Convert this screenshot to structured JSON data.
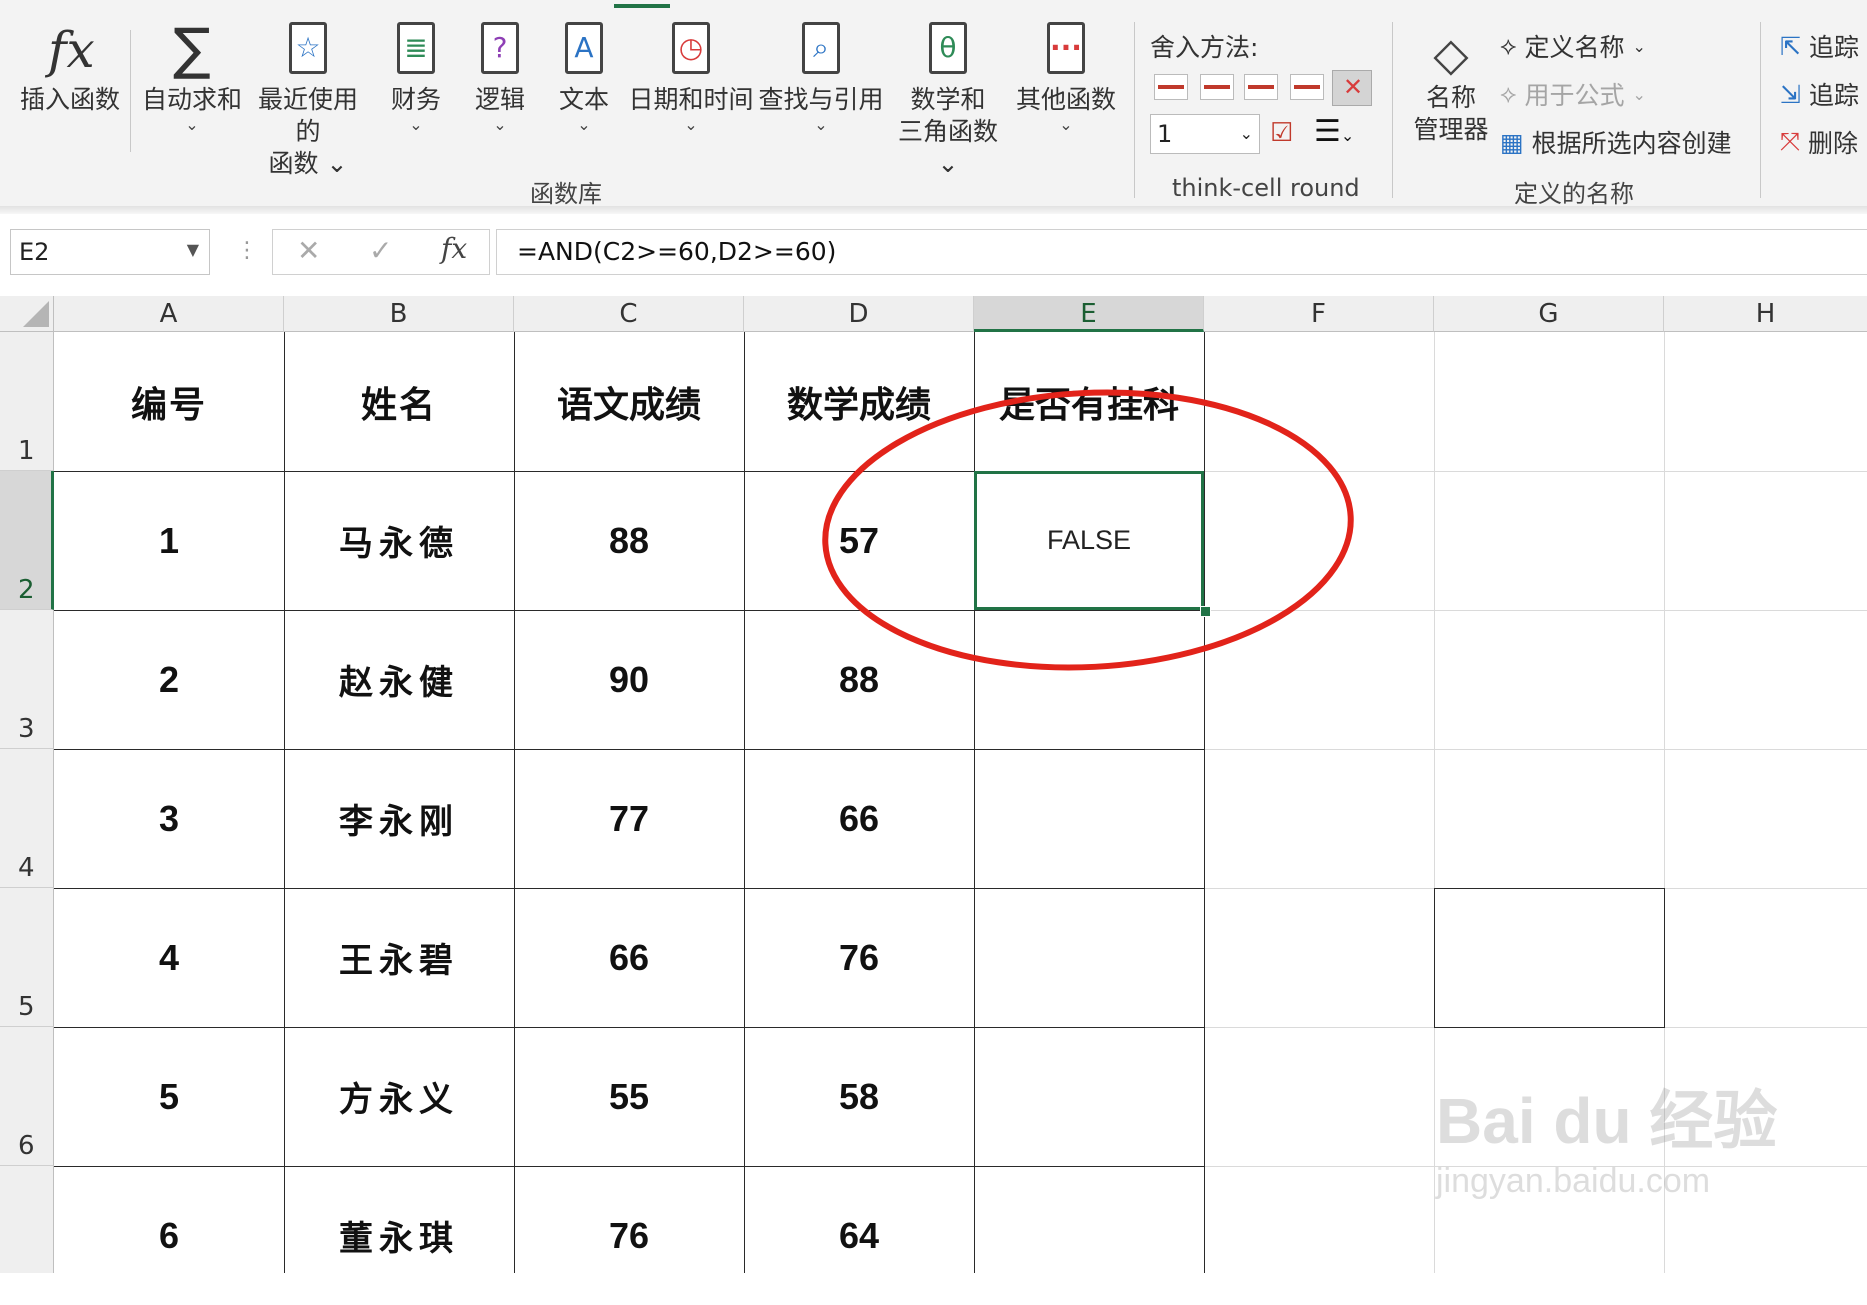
{
  "ribbon": {
    "buttons": [
      {
        "label": "插入函数",
        "sub": ""
      },
      {
        "label": "自动求和",
        "sub": "⌄"
      },
      {
        "label": "最近使用的",
        "sub": "函数 ⌄"
      },
      {
        "label": "财务",
        "sub": "⌄"
      },
      {
        "label": "逻辑",
        "sub": "⌄"
      },
      {
        "label": "文本",
        "sub": "⌄"
      },
      {
        "label": "日期和时间",
        "sub": "⌄"
      },
      {
        "label": "查找与引用",
        "sub": "⌄"
      },
      {
        "label": "数学和",
        "sub": "三角函数 ⌄"
      },
      {
        "label": "其他函数",
        "sub": "⌄"
      }
    ],
    "function_library_label": "函数库",
    "thinkcell": {
      "rounding_label": "舍入方法:",
      "value": "1",
      "group_label": "think-cell round"
    },
    "names": {
      "name_manager_line1": "名称",
      "name_manager_line2": "管理器",
      "define_name": "定义名称",
      "use_in_formula": "用于公式",
      "create_from_selection": "根据所选内容创建",
      "group_label": "定义的名称"
    },
    "audit": {
      "trace1": "追踪",
      "trace2": "追踪",
      "remove": "删除"
    }
  },
  "formula_bar": {
    "name_box": "E2",
    "formula": "=AND(C2>=60,D2>=60)"
  },
  "sheet": {
    "columns": [
      "A",
      "B",
      "C",
      "D",
      "E",
      "F",
      "G",
      "H"
    ],
    "rows": [
      "1",
      "2",
      "3",
      "4",
      "5",
      "6"
    ],
    "headers": [
      "编号",
      "姓名",
      "语文成绩",
      "数学成绩",
      "是否有挂科"
    ],
    "data": [
      [
        "1",
        "马永德",
        "88",
        "57",
        "FALSE"
      ],
      [
        "2",
        "赵永健",
        "90",
        "88",
        ""
      ],
      [
        "3",
        "李永刚",
        "77",
        "66",
        ""
      ],
      [
        "4",
        "王永碧",
        "66",
        "76",
        ""
      ],
      [
        "5",
        "方永义",
        "55",
        "58",
        ""
      ],
      [
        "6",
        "董永琪",
        "76",
        "64",
        ""
      ]
    ]
  },
  "watermark": {
    "brand": "Bai  du 经验",
    "url": "jingyan.baidu.com"
  },
  "colors": {
    "accent": "#217346",
    "annotation": "#e2231a"
  }
}
